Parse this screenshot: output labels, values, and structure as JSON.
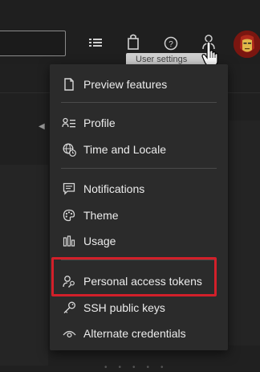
{
  "topbar": {
    "icons": [
      "list-icon",
      "shopping-bag-icon",
      "help-icon",
      "user-settings-icon"
    ],
    "tooltip": "User settings"
  },
  "menu": {
    "groups": [
      {
        "items": [
          {
            "label": "Preview features",
            "icon": "document-icon"
          }
        ]
      },
      {
        "items": [
          {
            "label": "Profile",
            "icon": "profile-card-icon"
          },
          {
            "label": "Time and Locale",
            "icon": "globe-clock-icon"
          }
        ]
      },
      {
        "items": [
          {
            "label": "Notifications",
            "icon": "chat-bubble-icon"
          },
          {
            "label": "Theme",
            "icon": "palette-icon"
          },
          {
            "label": "Usage",
            "icon": "bar-chart-icon"
          }
        ]
      },
      {
        "items": [
          {
            "label": "Personal access tokens",
            "icon": "user-key-icon",
            "highlighted": true
          },
          {
            "label": "SSH public keys",
            "icon": "key-icon"
          },
          {
            "label": "Alternate credentials",
            "icon": "eye-icon"
          }
        ]
      }
    ]
  },
  "colors": {
    "background": "#1e1e1e",
    "menu_background": "#2b2b2b",
    "highlight_border": "#d2202a",
    "text": "#ececec"
  }
}
